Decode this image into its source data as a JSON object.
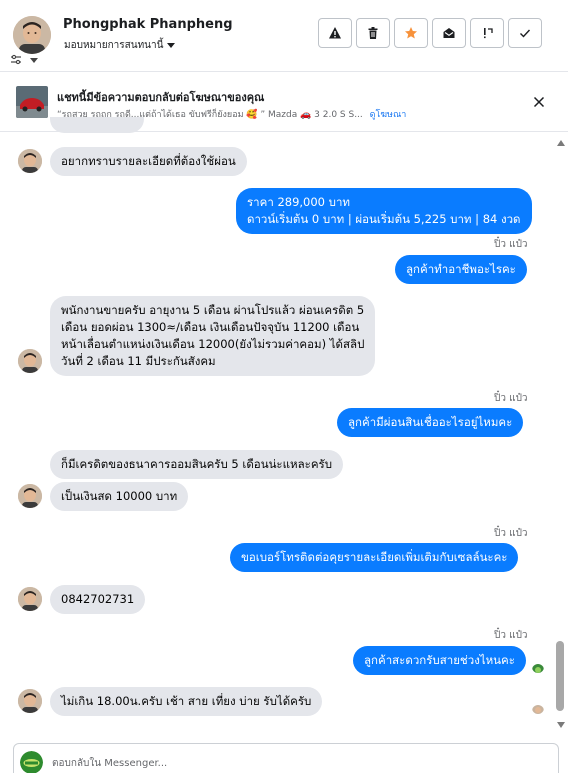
{
  "header": {
    "contact_name": "Phongphak Phanpheng",
    "assign_label": "มอบหมายการสนทนานี้",
    "actions": [
      {
        "name": "report-spam",
        "icon": "warning-icon"
      },
      {
        "name": "delete",
        "icon": "trash-icon"
      },
      {
        "name": "star",
        "icon": "star-icon"
      },
      {
        "name": "mark-unread",
        "icon": "open-envelope-icon"
      },
      {
        "name": "follow-up",
        "icon": "exclamation-icon"
      },
      {
        "name": "mark-done",
        "icon": "check-icon"
      }
    ]
  },
  "ad": {
    "title": "แชทนี้มีข้อความตอบกลับต่อโฆษณาของคุณ",
    "snippet": "“รถสวย รถถูก รถดี...แต่ถ้าได้เธอ ขับฟรีก็ยังยอม 🥰 ” Mazda 🚗 3 2.0 S S...",
    "link_label": "ดูโฆษณา"
  },
  "messages": [
    {
      "dir": "in",
      "text": "อยากทราบรายละเอียดที่ต้องใช้ผ่อน"
    },
    {
      "dir": "out",
      "lines": [
        "ราคา 289,000 บาท",
        "ดาวน์เริ่มต้น 0 บาท | ผ่อนเริ่มต้น 5,225 บาท | 84 งวด"
      ]
    },
    {
      "dir": "sender",
      "text": "ปิ๋ว แป๋ว"
    },
    {
      "dir": "out",
      "text": "ลูกค้าทำอาชีพอะไรคะ"
    },
    {
      "dir": "in",
      "lines": [
        "พนักงานขายครับ อายุงาน 5 เดือน ผ่านโปรแล้ว ผ่อนเครดิต 5",
        "เดือน ยอดผ่อน 1300≈/เดือน เงินเดือนปัจจุบัน 11200 เดือน",
        "หน้าเลื่อนตำแหน่งเงินเดือน 12000(ยังไม่รวมค่าคอม) ได้สลิป",
        "วันที่ 2 เดือน 11 มีประกันสังคม"
      ]
    },
    {
      "dir": "sender",
      "text": "ปิ๋ว แป๋ว"
    },
    {
      "dir": "out",
      "text": "ลูกค้ามีผ่อนสินเชื่ออะไรอยู่ไหมคะ"
    },
    {
      "dir": "in",
      "text": "ก็มีเครดิตของธนาคารออมสินครับ 5 เดือนน่ะแหละครับ"
    },
    {
      "dir": "in",
      "text": "เป็นเงินสด 10000 บาท"
    },
    {
      "dir": "sender",
      "text": "ปิ๋ว แป๋ว"
    },
    {
      "dir": "out",
      "text": "ขอเบอร์โทรติดต่อคุยรายละเอียดเพิ่มเติมกับเซลล์นะคะ"
    },
    {
      "dir": "in",
      "text": "0842702731"
    },
    {
      "dir": "sender",
      "text": "ปิ๋ว แป๋ว"
    },
    {
      "dir": "out",
      "text": "ลูกค้าสะดวกรับสายช่วงไหนคะ"
    },
    {
      "dir": "in",
      "text": "ไม่เกิน 18.00น.ครับ เช้า สาย เที่ยง บ่าย รับได้ครับ"
    }
  ],
  "reply": {
    "placeholder": "ตอบกลับใน Messenger..."
  },
  "colors": {
    "outgoing_bubble": "#0a7cff",
    "incoming_bubble": "#e4e6eb",
    "link": "#1877f2",
    "star": "#f7923b"
  }
}
